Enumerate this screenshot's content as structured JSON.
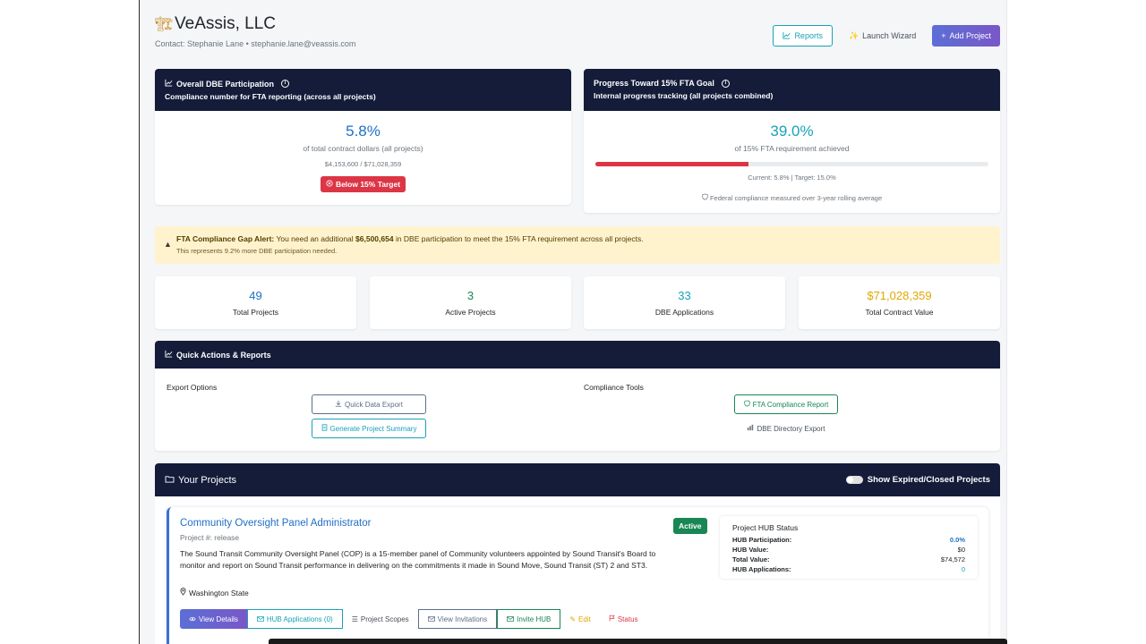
{
  "header": {
    "company_name": "VeAssis, LLC",
    "contact": "Contact: Stephanie Lane • stephanie.lane@veassis.com",
    "buttons": {
      "reports": "Reports",
      "wizard": "Launch Wizard",
      "add": "Add Project"
    }
  },
  "overall_dbe": {
    "title": "Overall DBE Participation",
    "subtitle": "Compliance number for FTA reporting (across all projects)",
    "percent": "5.8%",
    "caption": "of total contract dollars (all projects)",
    "amounts": "$4,153,600 / $71,028,359",
    "status_badge": "Below 15% Target"
  },
  "progress_goal": {
    "title": "Progress Toward 15% FTA Goal",
    "subtitle": "Internal progress tracking (all projects combined)",
    "percent": "39.0%",
    "progress_value": 0.39,
    "caption": "of 15% FTA requirement achieved",
    "current_target": "Current: 5.8% | Target: 15.0%",
    "note": "Federal compliance measured over 3-year rolling average"
  },
  "alert": {
    "label": "FTA Compliance Gap Alert:",
    "text_before": " You need an additional ",
    "amount": "$6,500,654",
    "text_after": " in DBE participation to meet the 15% FTA requirement across all projects.",
    "detail": "This represents 9.2% more DBE participation needed."
  },
  "metrics": [
    {
      "value": "49",
      "label": "Total Projects",
      "color": "#1f6fc7"
    },
    {
      "value": "3",
      "label": "Active Projects",
      "color": "#198754"
    },
    {
      "value": "33",
      "label": "DBE Applications",
      "color": "#17a2b8"
    },
    {
      "value": "$71,028,359",
      "label": "Total Contract Value",
      "color": "#e0a800"
    }
  ],
  "quick_actions": {
    "title": "Quick Actions & Reports",
    "export_label": "Export Options",
    "compliance_label": "Compliance Tools",
    "quick_export": "Quick Data Export",
    "project_summary": "Generate Project Summary",
    "fta_report": "FTA Compliance Report",
    "dbe_directory": "DBE Directory Export"
  },
  "projects": {
    "title": "Your Projects",
    "toggle_label": "Show Expired/Closed Projects",
    "items": [
      {
        "name": "Community Oversight Panel Administrator",
        "number": "Project #: release",
        "description": "The Sound Transit Community Oversight Panel (COP) is a 15-member panel of Community volunteers appointed by Sound Transit's Board to monitor and report on Sound Transit performance in delivering on the commitments it made in Sound Move, Sound Transit (ST) 2 and ST3.",
        "location": "Washington State",
        "status": "Active",
        "hub": {
          "title": "Project HUB Status",
          "participation_label": "HUB Participation:",
          "participation": "0.0%",
          "value_label": "HUB Value:",
          "value": "$0",
          "total_label": "Total Value:",
          "total": "$74,572",
          "apps_label": "HUB Applications:",
          "apps": "0"
        },
        "actions": {
          "view_details": "View Details",
          "hub_apps": "HUB Applications (0)",
          "scopes": "Project Scopes",
          "invitations": "View Invitations",
          "invite_hub": "Invite HUB",
          "edit": "Edit",
          "status": "Status"
        }
      }
    ]
  },
  "colors": {
    "navy_header": "#141c3a",
    "danger": "#dc3545",
    "primary_blue": "#1f6fc7",
    "teal": "#17a2b8",
    "success": "#198754",
    "warning": "#e0a800",
    "accent_purple": "#6e5fd2"
  },
  "icons": [
    "crane-icon",
    "chart-line-icon",
    "info-icon",
    "x-circle-icon",
    "shield-icon",
    "warning-triangle-icon",
    "download-icon",
    "document-icon",
    "bar-chart-icon",
    "folder-icon",
    "location-pin-icon",
    "eye-icon",
    "envelope-icon",
    "list-icon",
    "pencil-icon",
    "flag-icon",
    "magic-wand-icon",
    "plus-icon"
  ]
}
